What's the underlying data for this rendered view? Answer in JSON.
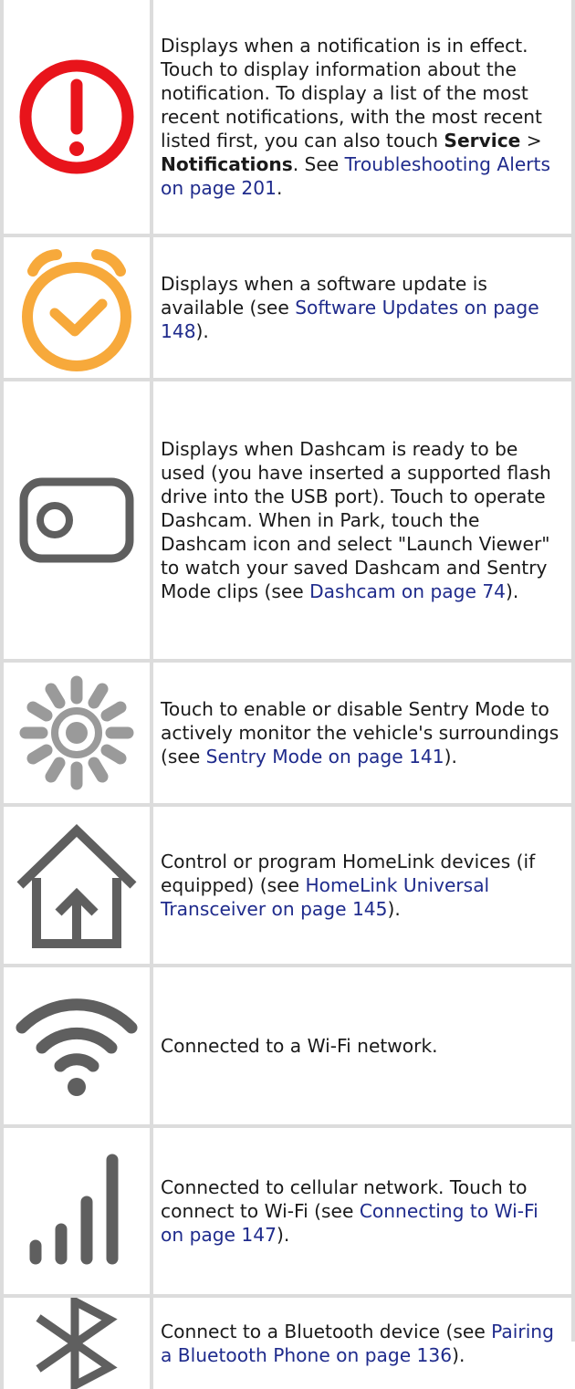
{
  "rows": [
    {
      "icon": "exclamation-alert-icon",
      "text_before": "Displays when a notification is in effect. Touch to display information about the notification. To display a list of the most recent notifications, with the most recent listed first, you can also touch ",
      "bold1": "Service",
      "sep": " > ",
      "bold2": "Notifications",
      "text_mid": ". See ",
      "link": "Troubleshooting Alerts on page 201",
      "text_after": "."
    },
    {
      "icon": "alarm-clock-icon",
      "text_before": "Displays when a software update is available (see ",
      "link": "Software Updates on page 148",
      "text_after": ")."
    },
    {
      "icon": "dashcam-icon",
      "text_before": "Displays when Dashcam is ready to be used (you have inserted a supported flash drive into the USB port). Touch to operate Dashcam. When in Park, touch the Dashcam icon and select \"Launch Viewer\" to watch your saved Dashcam and Sentry Mode clips (see ",
      "link": "Dashcam on page 74",
      "text_after": ")."
    },
    {
      "icon": "sentry-mode-icon",
      "text_before": "Touch to enable or disable Sentry Mode to actively monitor the vehicle's surroundings (see ",
      "link": "Sentry Mode on page 141",
      "text_after": ")."
    },
    {
      "icon": "homelink-house-icon",
      "text_before": "Control or program HomeLink devices (if equipped) (see ",
      "link": "HomeLink Universal Transceiver on page 145",
      "text_after": ")."
    },
    {
      "icon": "wifi-icon",
      "text_before": "Connected to a Wi-Fi network."
    },
    {
      "icon": "cellular-signal-icon",
      "text_before": "Connected to cellular network. Touch to connect to Wi-Fi (see ",
      "link": "Connecting to Wi-Fi on page 147",
      "text_after": ")."
    },
    {
      "icon": "bluetooth-icon",
      "text_before": "Connect to a Bluetooth device (see ",
      "link": "Pairing a Bluetooth Phone on page 136",
      "text_after": ")."
    }
  ],
  "colors": {
    "alert_red": "#e8141b",
    "clock_orange": "#f7a93b",
    "icon_gray": "#5f5f5f",
    "sentry_gray": "#9a9a9a",
    "link_blue": "#1f2b8c",
    "rule_gray": "#dcdcdc"
  }
}
